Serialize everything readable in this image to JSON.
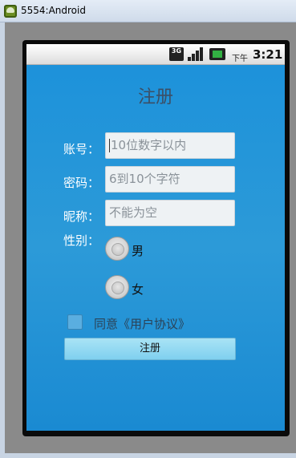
{
  "window": {
    "title": "5554:Android"
  },
  "statusbar": {
    "network": "3G",
    "ampm": "下午",
    "time": "3:21"
  },
  "form": {
    "title": "注册",
    "account_label": "账号：",
    "account_placeholder": "10位数字以内",
    "password_label": "密码：",
    "password_placeholder": "6到10个字符",
    "nickname_label": "昵称：",
    "nickname_placeholder": "不能为空",
    "gender_label": "性别：",
    "gender_options": [
      "男",
      "女"
    ],
    "agree_label": "同意《用户协议》",
    "submit_label": "注册"
  },
  "colors": {
    "screen_bg": "#1e90d8",
    "button": "#8fd6f1"
  }
}
